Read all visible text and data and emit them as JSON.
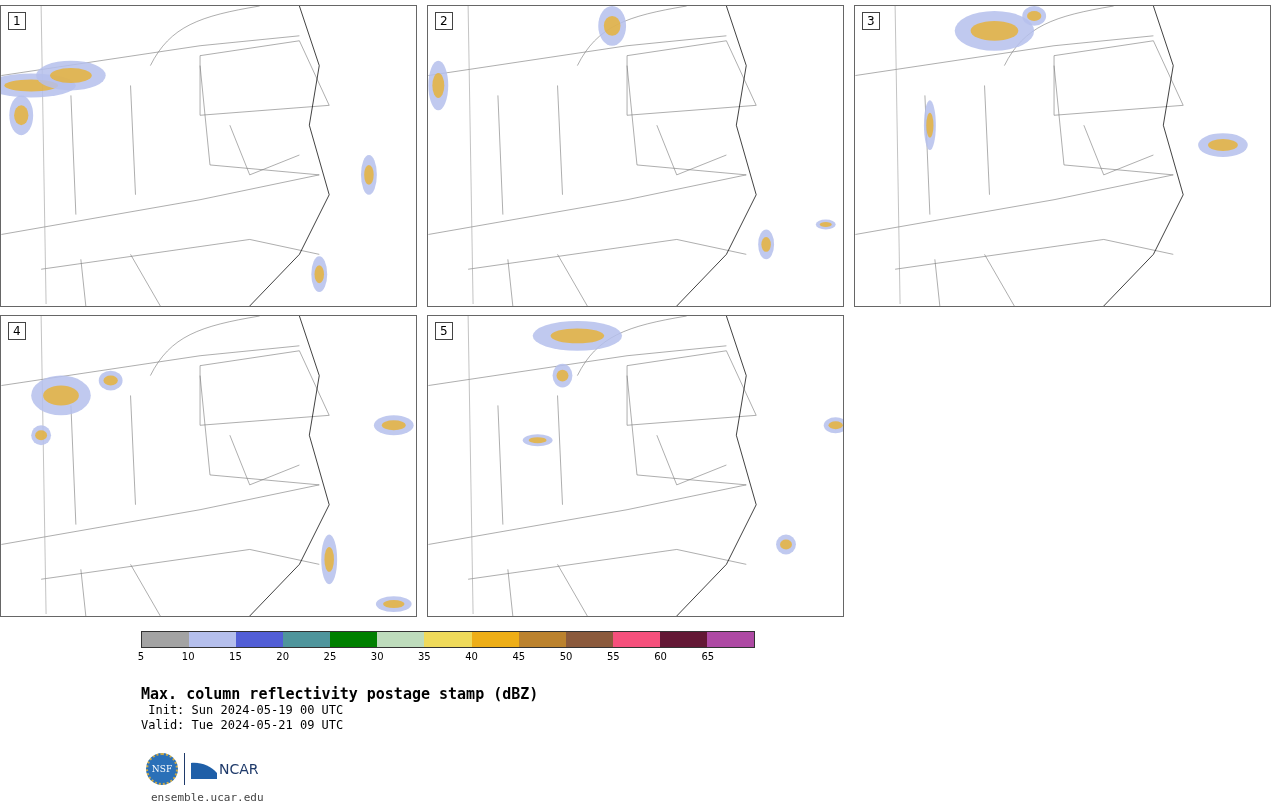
{
  "panels": [
    {
      "label": "1"
    },
    {
      "label": "2"
    },
    {
      "label": "3"
    },
    {
      "label": "4"
    },
    {
      "label": "5"
    }
  ],
  "colorbar": {
    "segments": [
      {
        "color": "#a3a3a3"
      },
      {
        "color": "#b5bfec"
      },
      {
        "color": "#525ed6"
      },
      {
        "color": "#4f959c"
      },
      {
        "color": "#008000"
      },
      {
        "color": "#bedcbc"
      },
      {
        "color": "#efda5b"
      },
      {
        "color": "#eeae17"
      },
      {
        "color": "#bb822e"
      },
      {
        "color": "#8b5a3c"
      },
      {
        "color": "#f5507c"
      },
      {
        "color": "#631835"
      },
      {
        "color": "#ae4aa4"
      }
    ],
    "ticks": [
      "5",
      "10",
      "15",
      "20",
      "25",
      "30",
      "35",
      "40",
      "45",
      "50",
      "55",
      "60",
      "65"
    ]
  },
  "title": "Max. column reflectivity postage stamp (dBZ)",
  "init": " Init: Sun 2024-05-19 00 UTC",
  "valid": "Valid: Tue 2024-05-21 09 UTC",
  "logo": {
    "nsf": "NSF",
    "ncar": "NCAR"
  },
  "link": "ensemble.ucar.edu"
}
